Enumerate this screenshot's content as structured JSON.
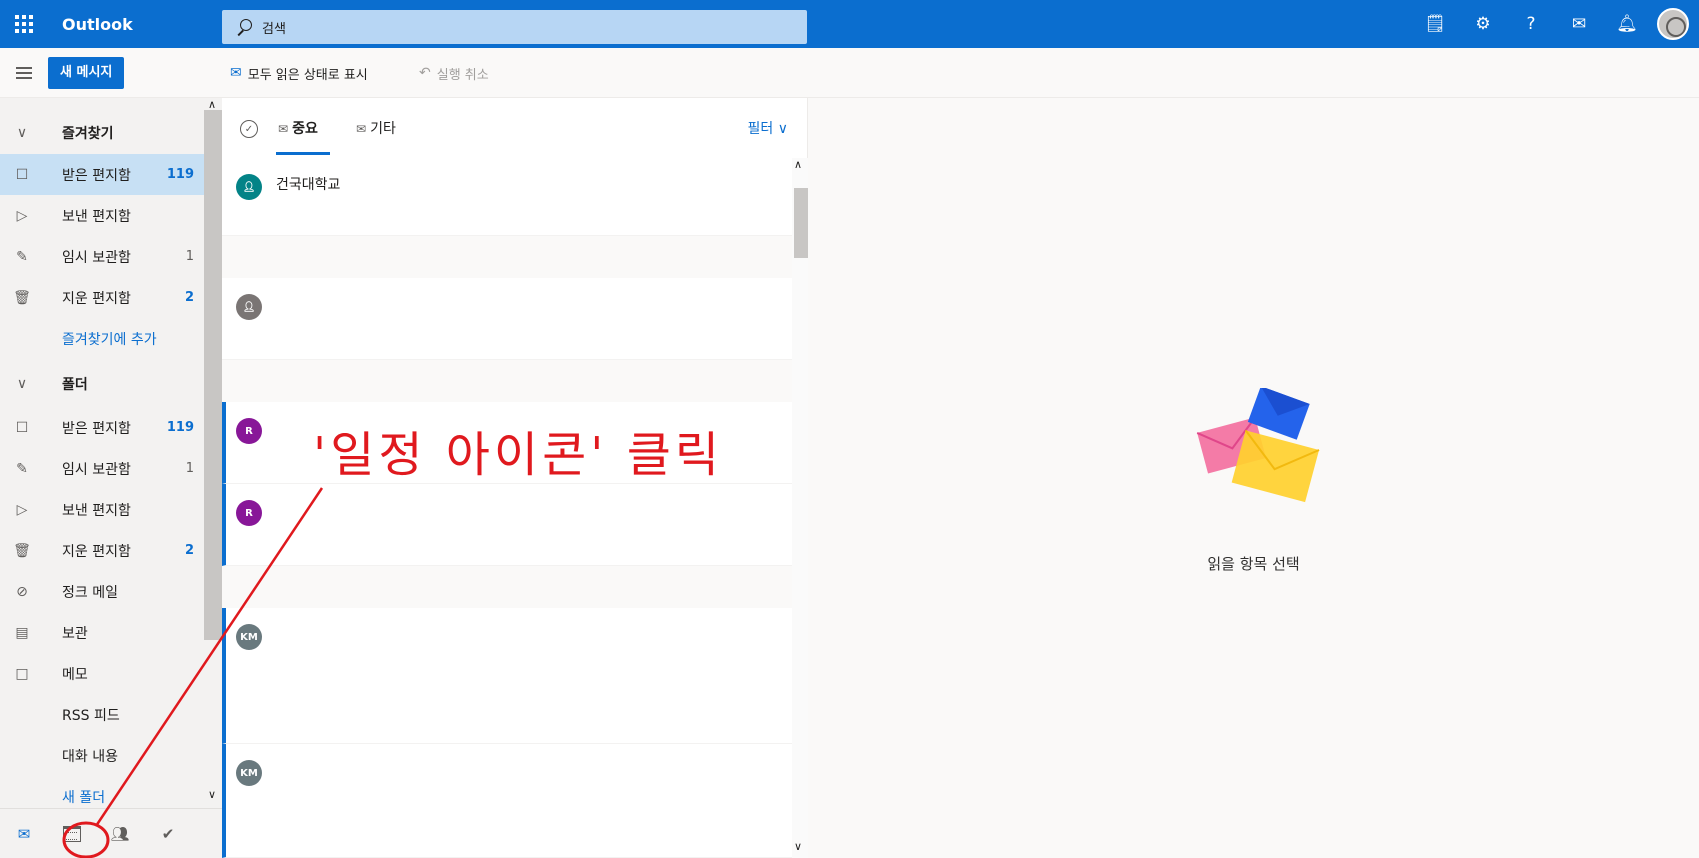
{
  "app": {
    "brand": "Outlook"
  },
  "search": {
    "placeholder": "검색"
  },
  "commandbar": {
    "new_message": "새 메시지",
    "mark_all_read": "모두 읽은 상태로 표시",
    "undo": "실행 취소"
  },
  "folders": {
    "favorites_header": "즐겨찾기",
    "favorites": [
      {
        "label": "받은 편지함",
        "count": "119",
        "icon": "inbox-icon"
      },
      {
        "label": "보낸 편지함",
        "count": "",
        "icon": "send-icon"
      },
      {
        "label": "임시 보관함",
        "count": "1",
        "icon": "pencil-icon"
      },
      {
        "label": "지운 편지함",
        "count": "2",
        "icon": "trash-icon"
      }
    ],
    "add_to_favorites": "즐겨찾기에 추가",
    "folders_header": "폴더",
    "items": [
      {
        "label": "받은 편지함",
        "count": "119",
        "icon": "inbox-icon"
      },
      {
        "label": "임시 보관함",
        "count": "1",
        "icon": "pencil-icon"
      },
      {
        "label": "보낸 편지함",
        "count": "",
        "icon": "send-icon"
      },
      {
        "label": "지운 편지함",
        "count": "2",
        "icon": "trash-icon"
      },
      {
        "label": "정크 메일",
        "count": "",
        "icon": "block-icon"
      },
      {
        "label": "보관",
        "count": "",
        "icon": "archive-icon"
      },
      {
        "label": "메모",
        "count": "",
        "icon": "note-icon"
      },
      {
        "label": "RSS 피드",
        "count": "",
        "icon": ""
      },
      {
        "label": "대화 내용",
        "count": "",
        "icon": ""
      }
    ],
    "new_folder": "새 폴더"
  },
  "list": {
    "tab_focused": "중요",
    "tab_other": "기타",
    "filter": "필터",
    "messages": [
      {
        "initials": "",
        "sender": "건국대학교",
        "color": "#038387",
        "unread": false
      },
      {
        "initials": "",
        "sender": "",
        "color": "#7a7574",
        "unread": false
      },
      {
        "initials": "R",
        "sender": "",
        "color": "#881798",
        "unread": true
      },
      {
        "initials": "R",
        "sender": "",
        "color": "#881798",
        "unread": true
      },
      {
        "initials": "KM",
        "sender": "",
        "color": "#69797e",
        "unread": true
      },
      {
        "initials": "KM",
        "sender": "",
        "color": "#69797e",
        "unread": true
      }
    ]
  },
  "reading": {
    "empty_text": "읽을 항목 선택"
  },
  "annotation": {
    "text": "'일정 아이콘' 클릭",
    "color": "#e0191e"
  },
  "colors": {
    "accent": "#0b6ecf",
    "selected": "#c7e0f4"
  }
}
